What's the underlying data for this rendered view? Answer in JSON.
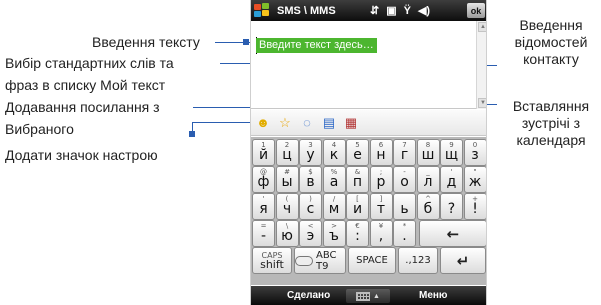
{
  "annotations": {
    "text_input": "Введення тексту",
    "std_phrases_line1": "Вибір стандартних слів та",
    "std_phrases_line2": "фраз в списку Мой текст",
    "favorites_line1": "Додавання посилання з",
    "favorites_line2": "Вибраного",
    "mood_icon": "Додати значок настрою",
    "contact_info": "Введення відомостей контакту",
    "calendar_meeting": "Вставляння зустрічі з календаря"
  },
  "status_bar": {
    "title": "SMS \\ MMS",
    "ok_label": "ok",
    "icons": [
      "data-connection-icon",
      "messaging-icon",
      "signal-icon",
      "volume-icon"
    ]
  },
  "message": {
    "text": "Введите текст здесь…"
  },
  "toolbar_icons": [
    "smiley-icon",
    "star-icon",
    "speech-bubble-icon",
    "contact-card-icon",
    "calendar-icon"
  ],
  "keyboard": {
    "rows": [
      [
        {
          "s": "1",
          "m": "й"
        },
        {
          "s": "2",
          "m": "ц"
        },
        {
          "s": "3",
          "m": "у"
        },
        {
          "s": "4",
          "m": "к"
        },
        {
          "s": "5",
          "m": "е"
        },
        {
          "s": "6",
          "m": "н"
        },
        {
          "s": "7",
          "m": "г"
        },
        {
          "s": "8",
          "m": "ш"
        },
        {
          "s": "9",
          "m": "щ"
        },
        {
          "s": "0",
          "m": "з"
        }
      ],
      [
        {
          "s": "@",
          "m": "ф"
        },
        {
          "s": "#",
          "m": "ы"
        },
        {
          "s": "$",
          "m": "в"
        },
        {
          "s": "%",
          "m": "а"
        },
        {
          "s": "&",
          "m": "п"
        },
        {
          "s": ";",
          "m": "р"
        },
        {
          "s": "-",
          "m": "о"
        },
        {
          "s": "_",
          "m": "л"
        },
        {
          "s": "'",
          "m": "д"
        },
        {
          "s": "\"",
          "m": "ж"
        }
      ],
      [
        {
          "s": "'",
          "m": "я"
        },
        {
          "s": "(",
          "m": "ч"
        },
        {
          "s": ")",
          "m": "с"
        },
        {
          "s": "/",
          "m": "м"
        },
        {
          "s": "[",
          "m": "и"
        },
        {
          "s": "]",
          "m": "т"
        },
        {
          "s": "",
          "m": "ь"
        },
        {
          "s": "^",
          "m": "б"
        },
        {
          "s": "",
          "m": "?"
        },
        {
          "s": "+",
          "m": "!"
        }
      ],
      [
        {
          "s": "=",
          "m": "-"
        },
        {
          "s": "\\",
          "m": "ю"
        },
        {
          "s": "<",
          "m": "э"
        },
        {
          "s": ">",
          "m": "ъ"
        },
        {
          "s": "€",
          "m": ":"
        },
        {
          "s": "¥",
          "m": ","
        },
        {
          "s": "*",
          "m": "."
        }
      ]
    ],
    "backspace": "←",
    "shift_top": "CAPS",
    "shift_bottom": "shift",
    "abc_label": "ABC T9",
    "space_label": "SPACE",
    "numbers_label": ".,123",
    "enter": "↵"
  },
  "softkeys": {
    "left": "Сделано",
    "right": "Меню"
  },
  "colors": {
    "accent": "#2a5db0",
    "input_highlight": "#4cb62f"
  }
}
